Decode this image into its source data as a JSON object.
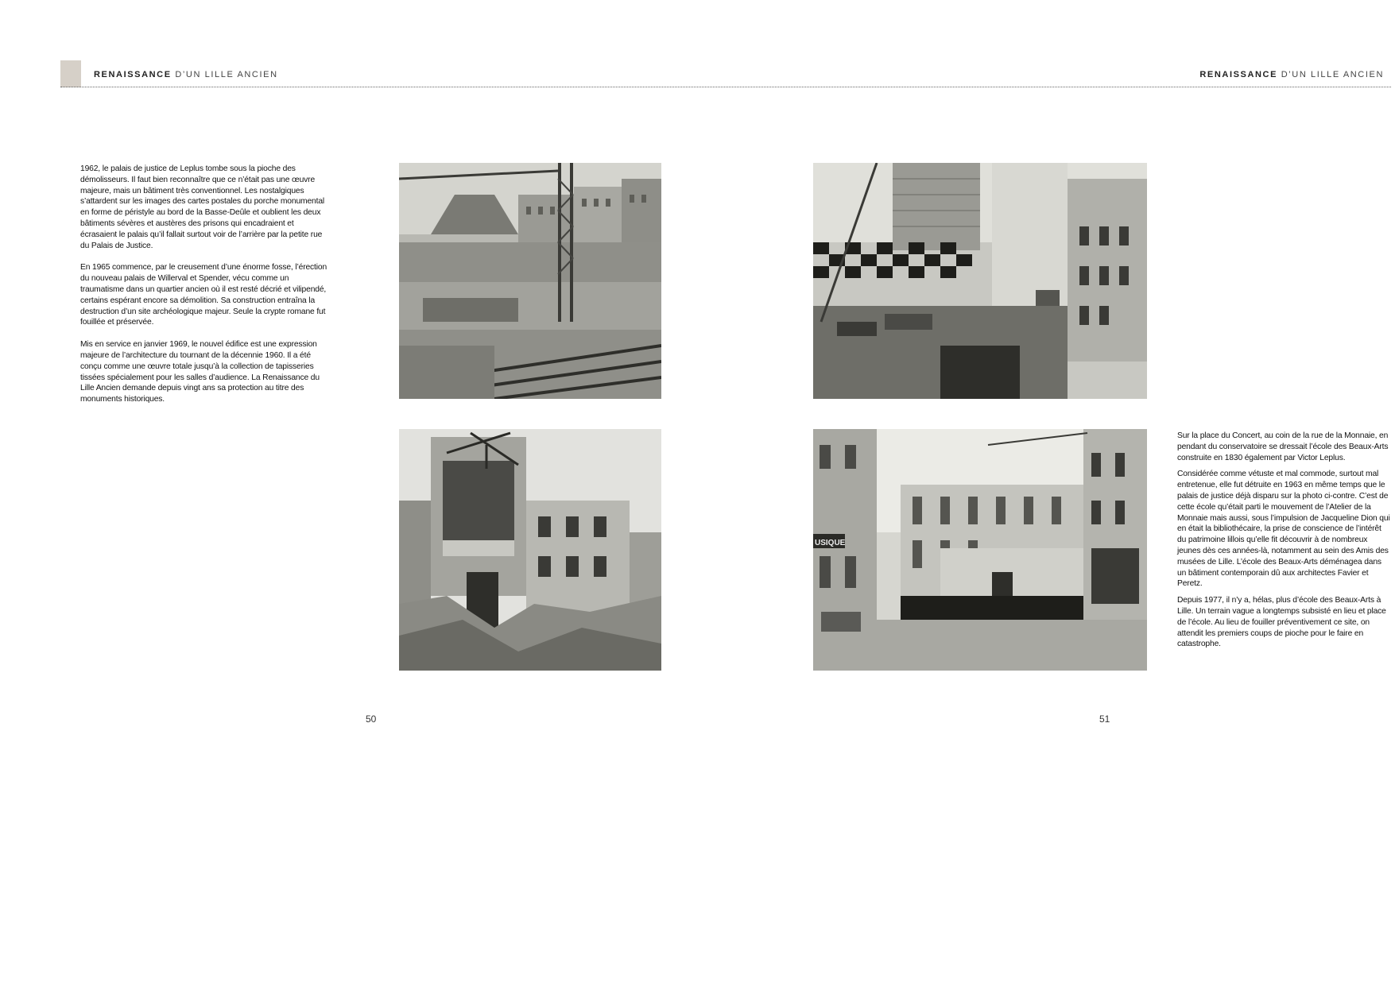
{
  "header": {
    "left": {
      "title_strong": "RENAISSANCE",
      "title_light": " D’UN LILLE ANCIEN"
    },
    "right": {
      "title_strong": "RENAISSANCE",
      "title_light": " D’UN LILLE ANCIEN"
    }
  },
  "left_page": {
    "paragraphs": [
      "1962, le palais de justice de Leplus tombe sous la pioche des démolisseurs. Il faut bien reconnaître que ce n’était pas une œuvre majeure, mais un bâtiment très conventionnel. Les nostalgiques s’attardent sur les images des cartes postales du porche monumental en forme de péristyle au bord de la Basse-Deûle et oublient les deux bâtiments sévères et austères des prisons qui encadraient et écrasaient le palais qu’il fallait surtout voir de l’arrière par la petite rue du Palais de Justice.",
      "En 1965 commence, par le creusement d’une énorme fosse, l’érection du nouveau palais de Willerval et Spender, vécu comme un traumatisme dans un quartier ancien où il est resté décrié et vilipendé, certains espérant encore sa démolition. Sa construction entraîna la destruction d’un site archéologique majeur. Seule la crypte romane fut fouillée et préservée.",
      " Mis en service en janvier 1969, le nouvel édifice est une expression majeure de l’architecture du tournant de la décennie 1960. Il a été conçu comme une œuvre totale jusqu’à la collection de tapisseries tissées spécialement pour les salles d’audience. La Renaissance du Lille Ancien demande depuis vingt ans sa protection au titre des monuments historiques."
    ],
    "page_number": "50"
  },
  "right_page": {
    "paragraphs": [
      "Sur la place du Concert, au coin de la rue de la Monnaie, en pendant du conservatoire se dressait l’école des Beaux-Arts construite en 1830 également par Victor Leplus.",
      "Considérée comme vétuste et mal commode, surtout mal entretenue, elle fut détruite en 1963 en même temps que le palais de justice déjà disparu sur la photo ci-contre. C’est de cette école qu’était parti le mouvement de l’Atelier de la Monnaie mais aussi, sous l’impulsion de Jacqueline Dion qui en était la bibliothécaire, la prise de conscience de l’intérêt du patrimoine lillois qu’elle fit découvrir à de nombreux jeunes dès ces années-là, notamment au sein des Amis des musées de Lille. L’école des Beaux-Arts déménagea dans un bâtiment contemporain dû aux architectes Favier et Peretz.",
      "Depuis 1977, il n’y a, hélas, plus d’école des Beaux-Arts à Lille. Un terrain vague a longtemps subsisté en lieu et place de l’école. Au lieu de fouiller préventivement ce site, on attendit les premiers coups de pioche pour le faire en catastrophe."
    ],
    "page_number": "51"
  },
  "photos": {
    "construction_site_sign": "USIQUE"
  }
}
